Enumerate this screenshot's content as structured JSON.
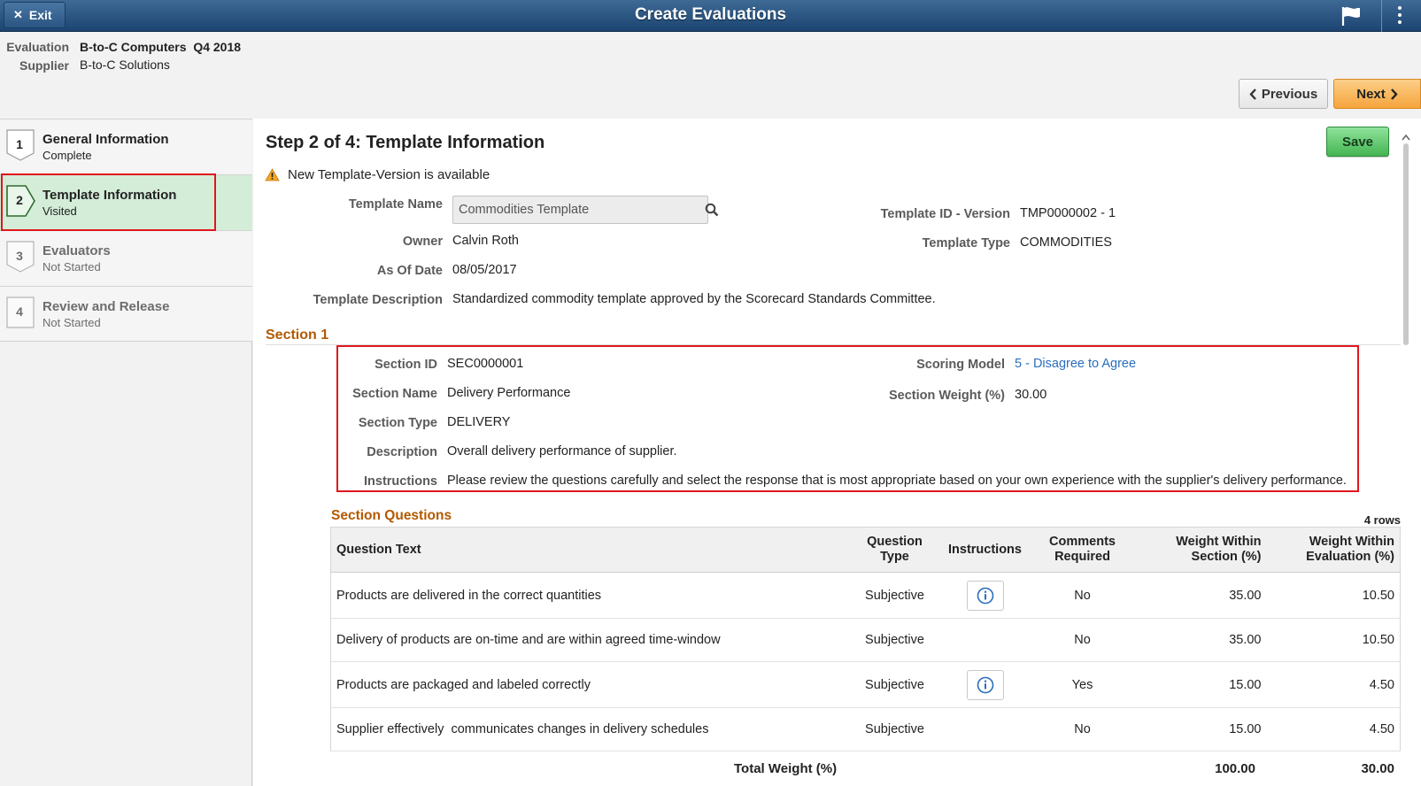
{
  "header": {
    "exit_label": "Exit",
    "title": "Create Evaluations"
  },
  "evaluation": {
    "evaluation_label": "Evaluation",
    "evaluation_value": "B-to-C Computers  Q4 2018",
    "supplier_label": "Supplier",
    "supplier_value": "B-to-C Solutions"
  },
  "nav": {
    "previous_label": "Previous",
    "next_label": "Next"
  },
  "steps": [
    {
      "number": "1",
      "title": "General Information",
      "status": "Complete"
    },
    {
      "number": "2",
      "title": "Template Information",
      "status": "Visited"
    },
    {
      "number": "3",
      "title": "Evaluators",
      "status": "Not Started"
    },
    {
      "number": "4",
      "title": "Review and Release",
      "status": "Not Started"
    }
  ],
  "main": {
    "heading": "Step 2 of 4: Template Information",
    "save_label": "Save",
    "warning": "New Template-Version is available",
    "template_name_label": "Template Name",
    "template_name_value": "Commodities Template",
    "owner_label": "Owner",
    "owner_value": "Calvin Roth",
    "as_of_date_label": "As Of Date",
    "as_of_date_value": "08/05/2017",
    "description_label": "Template Description",
    "description_value": "Standardized commodity template approved by the Scorecard Standards Committee.",
    "template_id_label": "Template ID - Version",
    "template_id_value": "TMP0000002 - 1",
    "template_type_label": "Template Type",
    "template_type_value": "COMMODITIES"
  },
  "section": {
    "title": "Section 1",
    "section_id_label": "Section ID",
    "section_id_value": "SEC0000001",
    "section_name_label": "Section Name",
    "section_name_value": "Delivery Performance",
    "section_type_label": "Section Type",
    "section_type_value": "DELIVERY",
    "description_label": "Description",
    "description_value": "Overall delivery performance of supplier.",
    "instructions_label": "Instructions",
    "instructions_value": "Please review the questions carefully and select the response that is most appropriate based on your own experience with the supplier's delivery performance.",
    "scoring_model_label": "Scoring Model",
    "scoring_model_value": "5 - Disagree to Agree",
    "section_weight_label": "Section Weight (%)",
    "section_weight_value": "30.00"
  },
  "questions": {
    "title": "Section Questions",
    "row_count": "4 rows",
    "columns": [
      "Question Text",
      "Question Type",
      "Instructions",
      "Comments Required",
      "Weight Within Section (%)",
      "Weight Within Evaluation (%)"
    ],
    "rows": [
      {
        "text": "Products are delivered in the correct quantities",
        "type": "Subjective",
        "has_instructions": true,
        "comments": "No",
        "w_section": "35.00",
        "w_eval": "10.50"
      },
      {
        "text": "Delivery of products are on-time and are within agreed time-window",
        "type": "Subjective",
        "has_instructions": false,
        "comments": "No",
        "w_section": "35.00",
        "w_eval": "10.50"
      },
      {
        "text": "Products are packaged and labeled correctly",
        "type": "Subjective",
        "has_instructions": true,
        "comments": "Yes",
        "w_section": "15.00",
        "w_eval": "4.50"
      },
      {
        "text": "Supplier effectively  communicates changes in delivery schedules",
        "type": "Subjective",
        "has_instructions": false,
        "comments": "No",
        "w_section": "15.00",
        "w_eval": "4.50"
      }
    ],
    "total_label": "Total Weight (%)",
    "total_section": "100.00",
    "total_eval": "30.00"
  },
  "icons": {
    "flag": "flag-icon",
    "menu": "kebab-menu-icon",
    "search": "search-icon",
    "warning": "warning-icon",
    "info": "info-icon"
  },
  "colors": {
    "header": "#1d4470",
    "next_button": "#f5a43c",
    "save_button": "#44b552",
    "current_step": "#d4edd8",
    "section_title": "#b35900",
    "highlight": "#e0161c",
    "link": "#2a6ebb"
  }
}
